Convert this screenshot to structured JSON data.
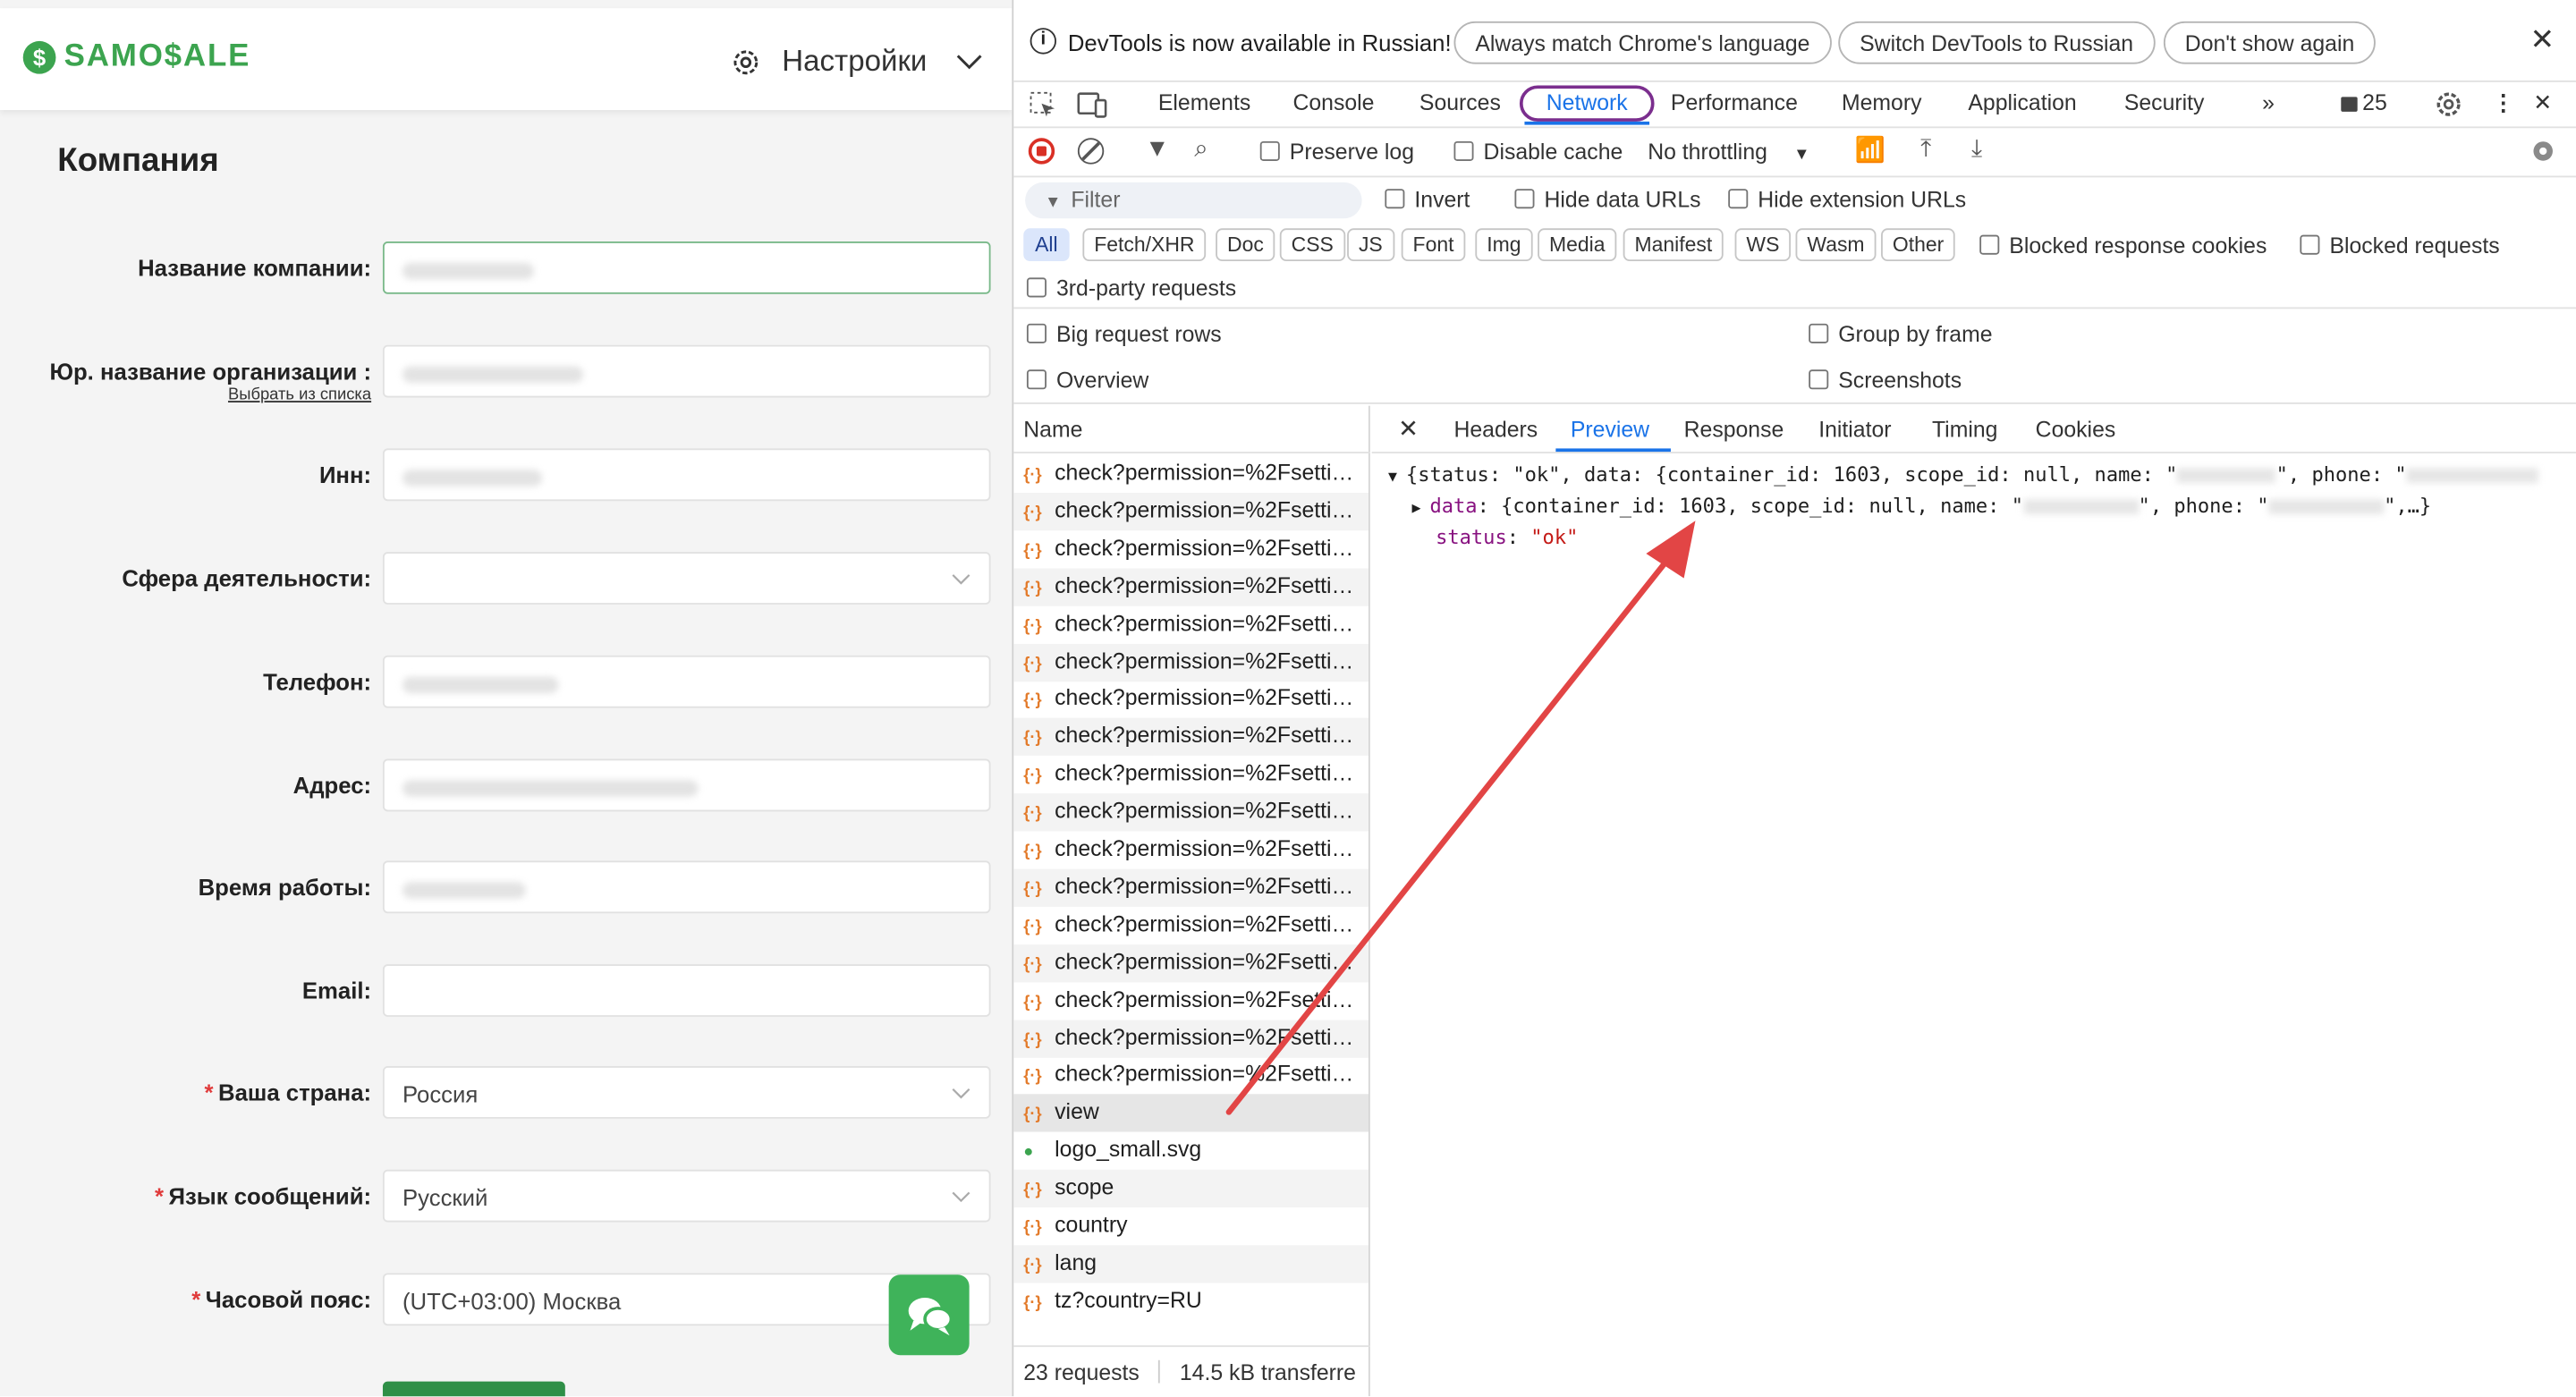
{
  "app": {
    "logo_text": "SAMO$ALE",
    "settings_label": "Настройки"
  },
  "page": {
    "title": "Компания"
  },
  "form": [
    {
      "label": "Название компании",
      "value": "",
      "type": "text"
    },
    {
      "label": "Юр. название организации",
      "value": "",
      "type": "text",
      "sublink": "Выбрать из списка"
    },
    {
      "label": "Инн",
      "value": "",
      "type": "text"
    },
    {
      "label": "Сфера деятельности",
      "value": "",
      "type": "select"
    },
    {
      "label": "Телефон",
      "value": "",
      "type": "text"
    },
    {
      "label": "Адрес",
      "value": "",
      "type": "text"
    },
    {
      "label": "Время работы",
      "value": "",
      "type": "text"
    },
    {
      "label": "Email",
      "value": "",
      "type": "text"
    },
    {
      "label": "Ваша страна",
      "value": "Россия",
      "type": "select",
      "required": true
    },
    {
      "label": "Язык сообщений",
      "value": "Русский",
      "type": "select",
      "required": true
    },
    {
      "label": "Часовой пояс",
      "value": "(UTC+03:00) Москва",
      "type": "select",
      "required": true
    }
  ],
  "devtools": {
    "infobar": {
      "text": "DevTools is now available in Russian!",
      "buttons": [
        "Always match Chrome's language",
        "Switch DevTools to Russian",
        "Don't show again"
      ]
    },
    "tabs": [
      "Elements",
      "Console",
      "Sources",
      "Network",
      "Performance",
      "Memory",
      "Application",
      "Security"
    ],
    "active_tab": "Network",
    "issues_count": "25",
    "toolbar": {
      "preserve_log": "Preserve log",
      "disable_cache": "Disable cache",
      "throttling": "No throttling"
    },
    "filter": {
      "placeholder": "Filter",
      "invert": "Invert",
      "hide_data_urls": "Hide data URLs",
      "hide_extension_urls": "Hide extension URLs"
    },
    "type_filters": [
      "All",
      "Fetch/XHR",
      "Doc",
      "CSS",
      "JS",
      "Font",
      "Img",
      "Media",
      "Manifest",
      "WS",
      "Wasm",
      "Other"
    ],
    "blocked_response_cookies": "Blocked response cookies",
    "blocked_requests": "Blocked requests",
    "third_party": "3rd-party requests",
    "options": {
      "big_rows": "Big request rows",
      "group_by_frame": "Group by frame",
      "overview": "Overview",
      "screenshots": "Screenshots"
    },
    "name_header": "Name",
    "requests": [
      "check?permission=%2Fsetti…",
      "check?permission=%2Fsetti…",
      "check?permission=%2Fsetti…",
      "check?permission=%2Fsetti…",
      "check?permission=%2Fsetti…",
      "check?permission=%2Fsetti…",
      "check?permission=%2Fsetti…",
      "check?permission=%2Fsetti…",
      "check?permission=%2Fsetti…",
      "check?permission=%2Fsetti…",
      "check?permission=%2Fsetti…",
      "check?permission=%2Fsetti…",
      "check?permission=%2Fsetti…",
      "check?permission=%2Fsetti…",
      "check?permission=%2Fsetti…",
      "check?permission=%2Fsetti…",
      "check?permission=%2Fsetti…",
      "view",
      "logo_small.svg",
      "scope",
      "country",
      "lang",
      "tz?country=RU"
    ],
    "selected_request": "view",
    "status": {
      "requests": "23 requests",
      "transferred": "14.5 kB transferre"
    },
    "detail_tabs": [
      "Headers",
      "Preview",
      "Response",
      "Initiator",
      "Timing",
      "Cookies"
    ],
    "active_detail_tab": "Preview",
    "preview": {
      "line1": "{status: \"ok\", data: {container_id: 1603, scope_id: null, name: \"",
      "line1_mid": "\", phone: \"",
      "line2_key": "data",
      "line2": ": {container_id: 1603, scope_id: null, name: \"",
      "line2_mid": "\", phone: \"",
      "line2_end": "\",…}",
      "line3_key": "status",
      "line3_value": "\"ok\""
    },
    "annotation_color": "#e24545"
  }
}
